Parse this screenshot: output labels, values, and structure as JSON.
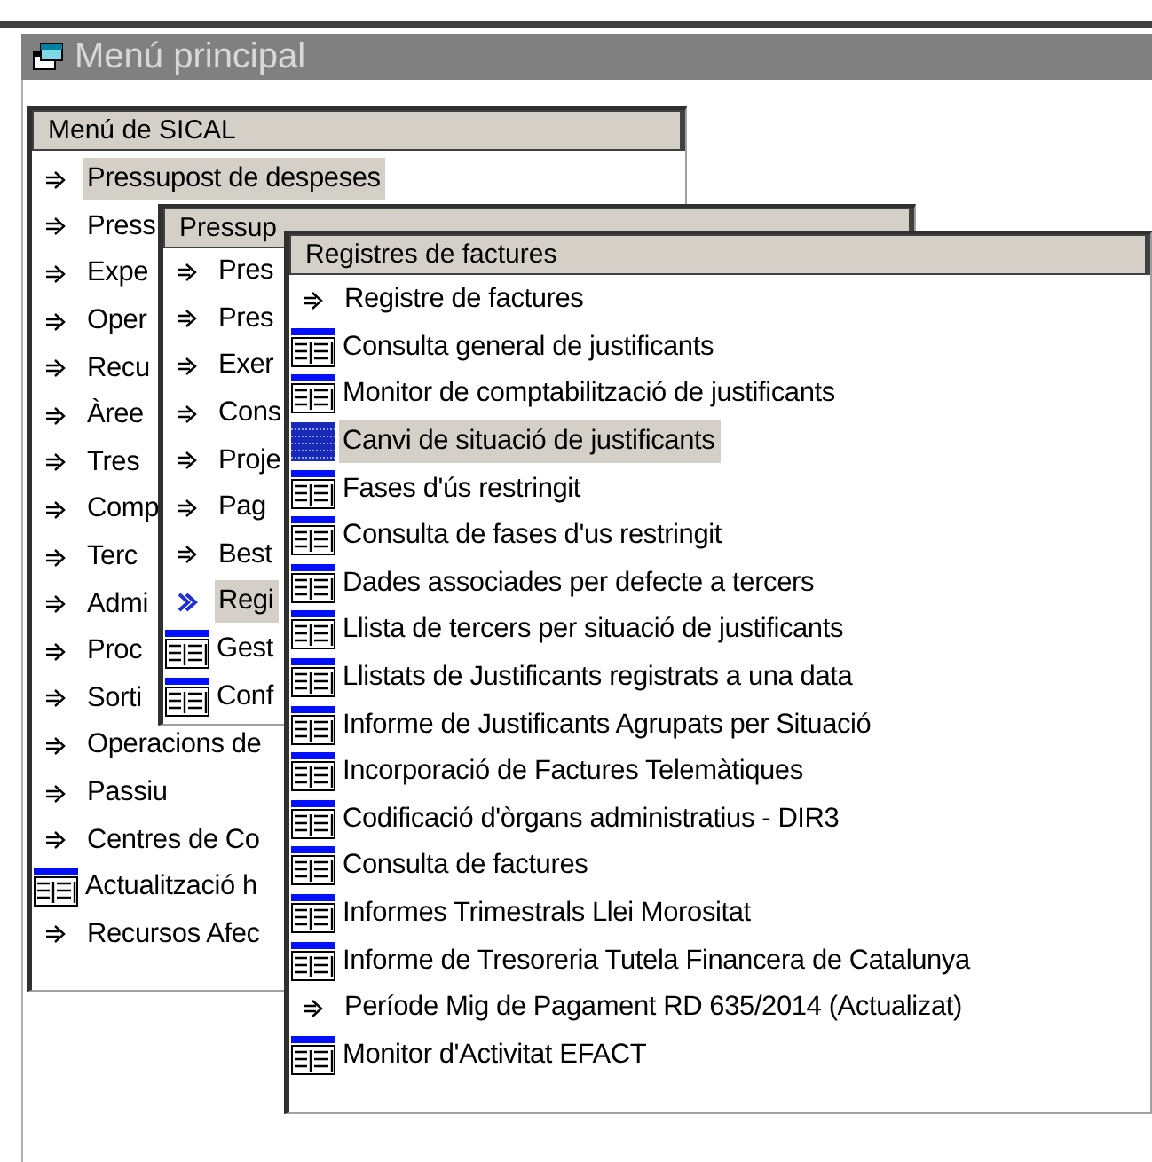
{
  "window": {
    "title": "Menú principal"
  },
  "panels": [
    {
      "header": "Menú de SICAL",
      "items": [
        {
          "kind": "submenu",
          "label": "Pressupost de despeses",
          "selected": true,
          "highlighted": false
        },
        {
          "kind": "submenu",
          "label": "Press",
          "selected": false,
          "highlighted": false
        },
        {
          "kind": "submenu",
          "label": "Expe",
          "selected": false,
          "highlighted": false
        },
        {
          "kind": "submenu",
          "label": "Oper",
          "selected": false,
          "highlighted": false
        },
        {
          "kind": "submenu",
          "label": "Recu",
          "selected": false,
          "highlighted": false
        },
        {
          "kind": "submenu",
          "label": "Àree",
          "selected": false,
          "highlighted": false
        },
        {
          "kind": "submenu",
          "label": "Tres",
          "selected": false,
          "highlighted": false
        },
        {
          "kind": "submenu",
          "label": "Comp",
          "selected": false,
          "highlighted": false
        },
        {
          "kind": "submenu",
          "label": "Terc",
          "selected": false,
          "highlighted": false
        },
        {
          "kind": "submenu",
          "label": "Admi",
          "selected": false,
          "highlighted": false
        },
        {
          "kind": "submenu",
          "label": "Proc",
          "selected": false,
          "highlighted": false
        },
        {
          "kind": "submenu",
          "label": "Sorti",
          "selected": false,
          "highlighted": false
        },
        {
          "kind": "submenu",
          "label": "Operacions de",
          "selected": false,
          "highlighted": false
        },
        {
          "kind": "submenu",
          "label": "Passiu",
          "selected": false,
          "highlighted": false
        },
        {
          "kind": "submenu",
          "label": "Centres de Co",
          "selected": false,
          "highlighted": false
        },
        {
          "kind": "form",
          "label": "Actualització h",
          "selected": false,
          "highlighted": false
        },
        {
          "kind": "submenu",
          "label": "Recursos Afec",
          "selected": false,
          "highlighted": false
        }
      ]
    },
    {
      "header": "Pressup",
      "items": [
        {
          "kind": "submenu",
          "label": "Pres",
          "selected": false,
          "highlighted": false
        },
        {
          "kind": "submenu",
          "label": "Pres",
          "selected": false,
          "highlighted": false
        },
        {
          "kind": "submenu",
          "label": "Exer",
          "selected": false,
          "highlighted": false
        },
        {
          "kind": "submenu",
          "label": "Cons",
          "selected": false,
          "highlighted": false
        },
        {
          "kind": "submenu",
          "label": "Proje",
          "selected": false,
          "highlighted": false
        },
        {
          "kind": "submenu",
          "label": "Pag",
          "selected": false,
          "highlighted": false
        },
        {
          "kind": "submenu",
          "label": "Best",
          "selected": false,
          "highlighted": false
        },
        {
          "kind": "submenu",
          "label": "Regi",
          "selected": true,
          "highlighted": true
        },
        {
          "kind": "form",
          "label": "Gest",
          "selected": false,
          "highlighted": false
        },
        {
          "kind": "form",
          "label": "Conf",
          "selected": false,
          "highlighted": false
        }
      ]
    },
    {
      "header": "Registres de factures",
      "items": [
        {
          "kind": "submenu",
          "label": "Registre de factures",
          "selected": false,
          "highlighted": false
        },
        {
          "kind": "form",
          "label": "Consulta general de justificants",
          "selected": false,
          "highlighted": false
        },
        {
          "kind": "form",
          "label": "Monitor de comptabilització de justificants",
          "selected": false,
          "highlighted": false
        },
        {
          "kind": "form",
          "label": "Canvi de situació de justificants",
          "selected": true,
          "highlighted": true
        },
        {
          "kind": "form",
          "label": "Fases d'ús restringit",
          "selected": false,
          "highlighted": false
        },
        {
          "kind": "form",
          "label": "Consulta de fases d'us restringit",
          "selected": false,
          "highlighted": false
        },
        {
          "kind": "form",
          "label": "Dades associades per defecte a tercers",
          "selected": false,
          "highlighted": false
        },
        {
          "kind": "form",
          "label": "Llista de tercers per situació de justificants",
          "selected": false,
          "highlighted": false
        },
        {
          "kind": "form",
          "label": "Llistats de Justificants registrats a una data",
          "selected": false,
          "highlighted": false
        },
        {
          "kind": "form",
          "label": "Informe de Justificants Agrupats per Situació",
          "selected": false,
          "highlighted": false
        },
        {
          "kind": "form",
          "label": "Incorporació de Factures Telemàtiques",
          "selected": false,
          "highlighted": false
        },
        {
          "kind": "form",
          "label": "Codificació d'òrgans administratius - DIR3",
          "selected": false,
          "highlighted": false
        },
        {
          "kind": "form",
          "label": "Consulta de factures",
          "selected": false,
          "highlighted": false
        },
        {
          "kind": "form",
          "label": "Informes Trimestrals Llei Morositat",
          "selected": false,
          "highlighted": false
        },
        {
          "kind": "form",
          "label": "Informe de Tresoreria Tutela Financera de Catalunya",
          "selected": false,
          "highlighted": false
        },
        {
          "kind": "submenu",
          "label": "Període Mig de Pagament RD 635/2014 (Actualizat)",
          "selected": false,
          "highlighted": false
        },
        {
          "kind": "form",
          "label": "Monitor d'Activitat EFACT",
          "selected": false,
          "highlighted": false
        }
      ]
    }
  ]
}
